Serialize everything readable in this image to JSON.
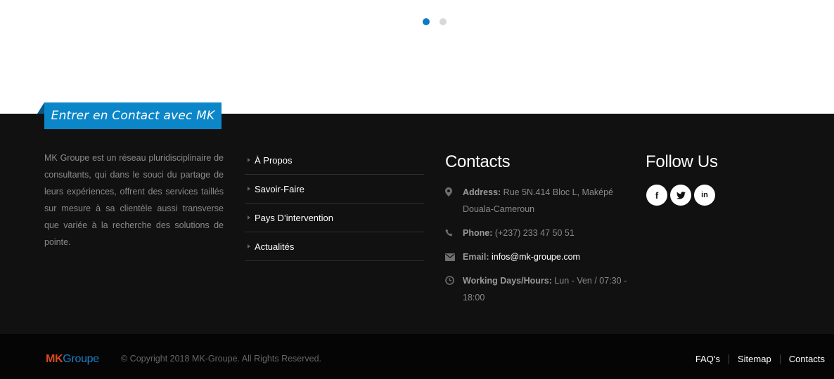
{
  "carousel": {
    "dots": 2,
    "active_index": 0
  },
  "footer": {
    "ribbon_title": "Entrer en Contact avec MK",
    "about_text": "MK Groupe est un réseau pluridisciplinaire de consultants, qui dans le souci du partage de leurs expériences, offrent des services taillés sur mesure à sa clientèle aussi transverse que variée à la recherche des solutions de pointe.",
    "links": [
      {
        "label": "À Propos"
      },
      {
        "label": "Savoir-Faire"
      },
      {
        "label": "Pays D’intervention"
      },
      {
        "label": "Actualités"
      }
    ],
    "contacts": {
      "title": "Contacts",
      "address_label": "Address:",
      "address_value": "Rue 5N.414 Bloc L, Maképé Douala-Cameroun",
      "phone_label": "Phone:",
      "phone_value": "(+237) 233 47 50 51",
      "email_label": "Email:",
      "email_value": "infos@mk-groupe.com",
      "hours_label": "Working Days/Hours:",
      "hours_value": "Lun - Ven / 07:30 - 18:00"
    },
    "follow": {
      "title": "Follow Us",
      "icons": [
        "facebook-icon",
        "twitter-icon",
        "linkedin-icon"
      ],
      "glyphs": {
        "facebook": "f",
        "twitter": "t",
        "linkedin": "in"
      }
    }
  },
  "bottom_bar": {
    "logo_mk": "MK",
    "logo_groupe": "Groupe",
    "copyright": "© Copyright 2018 MK-Groupe. All Rights Reserved.",
    "links": [
      {
        "label": "FAQ’s"
      },
      {
        "label": "Sitemap"
      },
      {
        "label": "Contacts"
      }
    ]
  },
  "colors": {
    "accent": "#0a86c9",
    "footer_bg": "#111111",
    "bottom_bg": "#050505",
    "logo_mk": "#d9481c",
    "logo_groupe": "#1c7fc7"
  }
}
